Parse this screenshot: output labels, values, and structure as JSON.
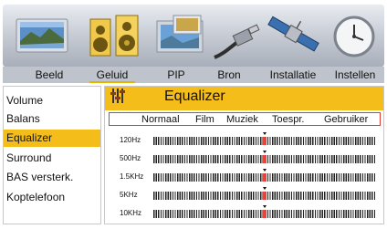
{
  "tabs": [
    {
      "label": "Beeld",
      "active": false
    },
    {
      "label": "Geluid",
      "active": true
    },
    {
      "label": "PIP",
      "active": false
    },
    {
      "label": "Bron",
      "active": false
    },
    {
      "label": "Installatie",
      "active": false
    },
    {
      "label": "Instellen",
      "active": false
    }
  ],
  "icons": [
    "tv-screen-icon",
    "speakers-icon",
    "pip-icon",
    "cable-plug-icon",
    "satellite-icon",
    "clock-icon"
  ],
  "menu": {
    "items": [
      {
        "label": "Volume",
        "active": false
      },
      {
        "label": "Balans",
        "active": false
      },
      {
        "label": "Equalizer",
        "active": true
      },
      {
        "label": "Surround",
        "active": false
      },
      {
        "label": "BAS versterk.",
        "active": false
      },
      {
        "label": "Koptelefoon",
        "active": false
      }
    ]
  },
  "panel": {
    "title": "Equalizer",
    "icon": "equalizer-sliders-icon",
    "presets": [
      "Normaal",
      "Film",
      "Muziek",
      "Toespr.",
      "Gebruiker"
    ],
    "bands": [
      {
        "label": "120Hz",
        "level": 0.5
      },
      {
        "label": "500Hz",
        "level": 0.5
      },
      {
        "label": "1.5KHz",
        "level": 0.5
      },
      {
        "label": "5KHz",
        "level": 0.5
      },
      {
        "label": "10KHz",
        "level": 0.5
      }
    ]
  },
  "colors": {
    "accent": "#f5bd19",
    "marker": "#e5453a",
    "tab_bar": "#bfc3cb"
  }
}
